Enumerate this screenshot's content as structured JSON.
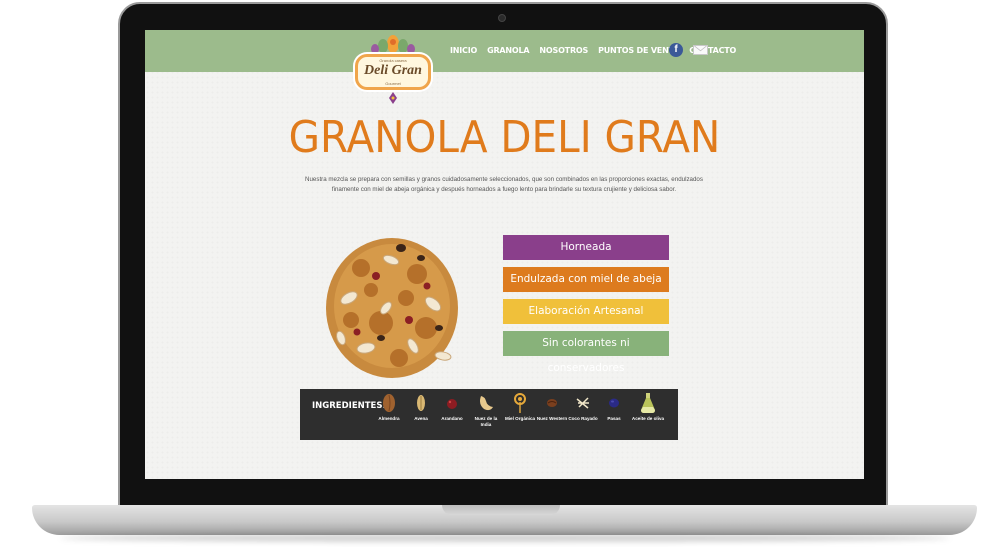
{
  "site": {
    "logo": {
      "small_text": "Granola casera",
      "name": "Deli Gran",
      "sub_text": "Gourmet"
    },
    "nav": [
      "INICIO",
      "GRANOLA",
      "NOSOTROS",
      "PUNTOS DE VENTA",
      "CONTACTO"
    ],
    "social": {
      "facebook": "f"
    }
  },
  "main": {
    "title": "GRANOLA DELI GRAN",
    "intro": "Nuestra mezcla se prepara con semillas y granos cuidadosamente seleccionados, que son combinados en las proporciones exactas, endulzados finamente con miel de abeja orgánica y después horneados a fuego lento para brindarle su textura crujiente y deliciosa sabor.",
    "features": [
      "Horneada",
      "Endulzada con miel de abeja",
      "Elaboración Artesanal",
      "Sin colorantes ni conservadores"
    ],
    "ingredients_label": "INGREDIENTES:",
    "ingredients": [
      {
        "name": "Almendra",
        "icon": "almond-icon"
      },
      {
        "name": "Avena",
        "icon": "oat-icon"
      },
      {
        "name": "Arandano",
        "icon": "cranberry-icon"
      },
      {
        "name": "Nuez de la India",
        "icon": "cashew-icon"
      },
      {
        "name": "Miel Orgánica",
        "icon": "honey-icon"
      },
      {
        "name": "Nuez Western",
        "icon": "walnut-icon"
      },
      {
        "name": "Coco Rayado",
        "icon": "coconut-icon"
      },
      {
        "name": "Pasas",
        "icon": "raisin-icon"
      },
      {
        "name": "Aceite de oliva",
        "icon": "olive-oil-icon"
      }
    ]
  },
  "colors": {
    "nav_bg": "#9cbb8c",
    "title": "#e07b1c",
    "feature_purple": "#8a3f8b",
    "feature_orange": "#dd7b1e",
    "feature_yellow": "#f0c03a",
    "feature_green": "#88b27a"
  }
}
